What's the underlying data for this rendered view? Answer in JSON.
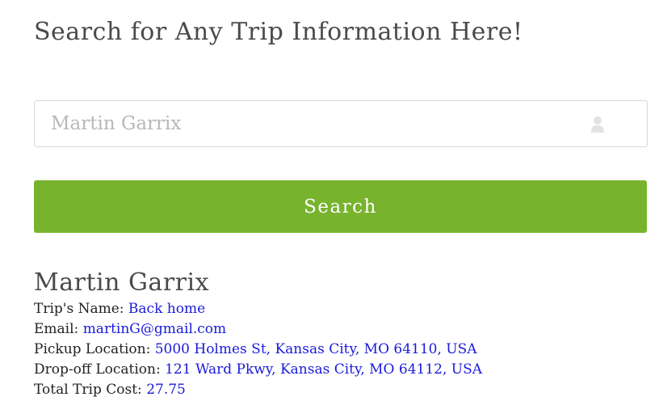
{
  "page": {
    "title": "Search for Any Trip Information Here!"
  },
  "search": {
    "value": "",
    "placeholder": "Martin Garrix",
    "icon": "user-icon",
    "button_label": "Search"
  },
  "result": {
    "name": "Martin Garrix",
    "fields": [
      {
        "label": "Trip's Name:",
        "value": "Back home"
      },
      {
        "label": "Email:",
        "value": "martinG@gmail.com"
      },
      {
        "label": "Pickup Location:",
        "value": "5000 Holmes St, Kansas City, MO 64110, USA"
      },
      {
        "label": "Drop-off Location:",
        "value": "121 Ward Pkwy, Kansas City, MO 64112, USA"
      },
      {
        "label": "Total Trip Cost:",
        "value": "27.75"
      }
    ]
  },
  "colors": {
    "button": "#78b32e",
    "value_text": "#1a1ad9",
    "heading": "#4a4a4a"
  }
}
